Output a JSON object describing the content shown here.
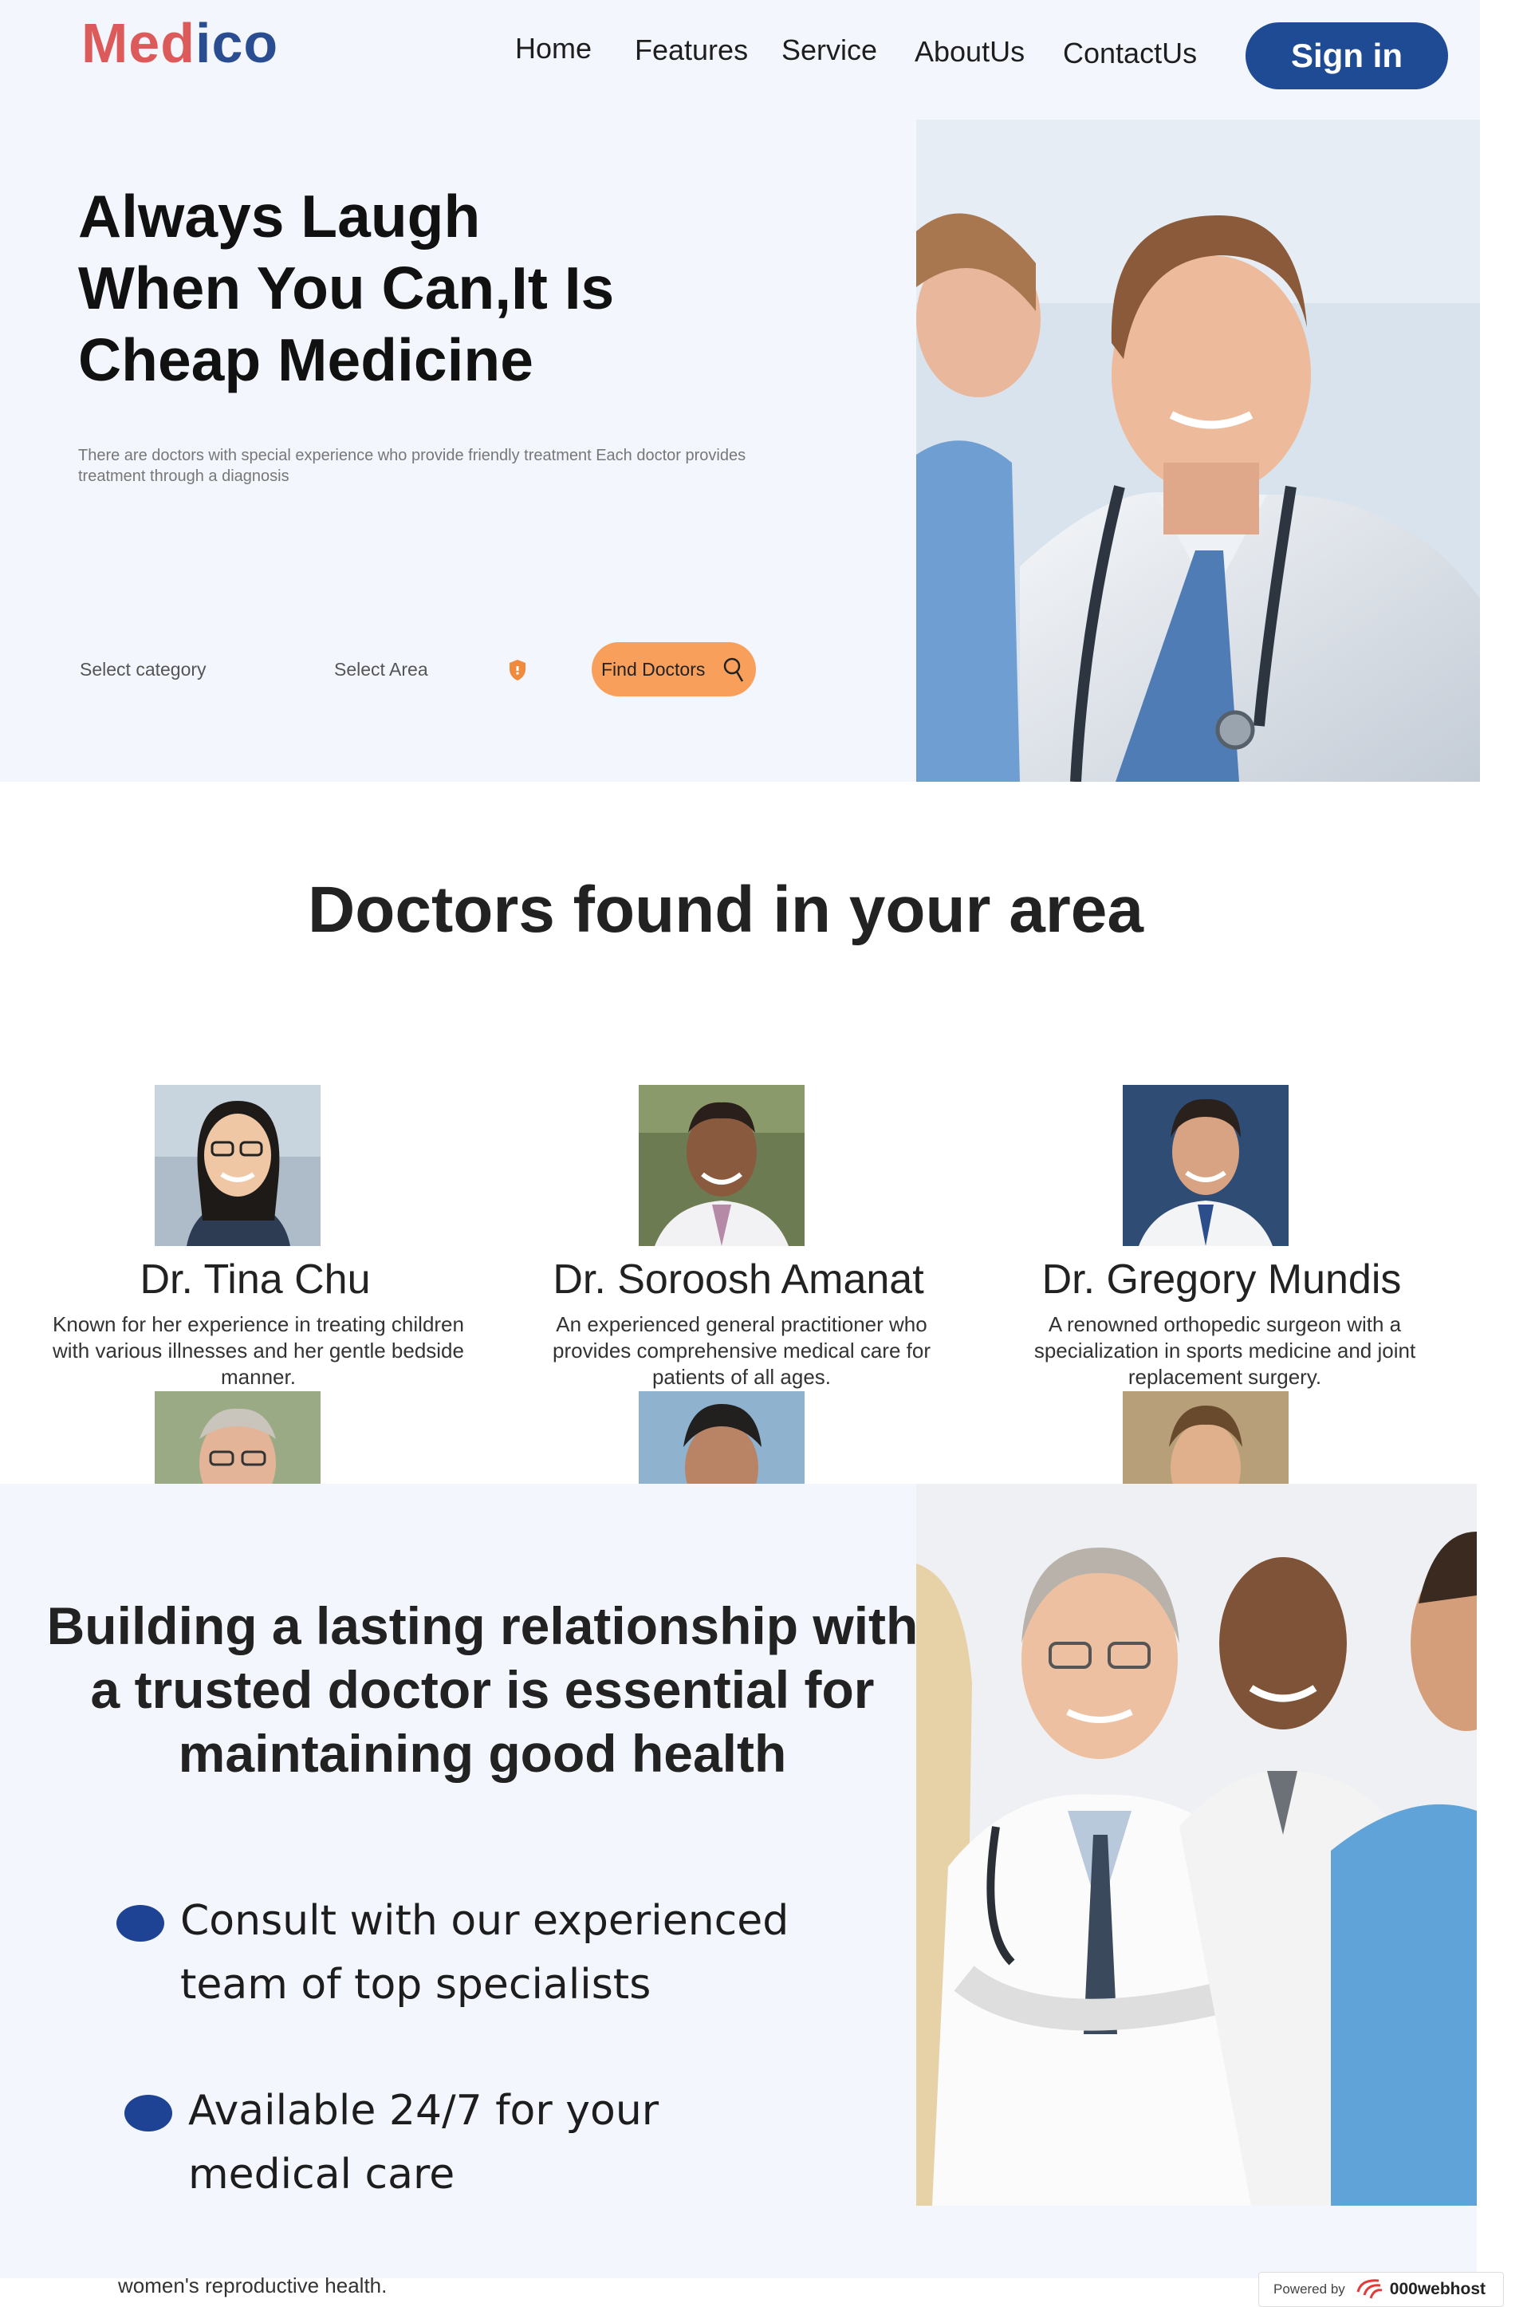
{
  "brand": {
    "part1": "Med",
    "part2": "ico"
  },
  "nav": {
    "home": "Home",
    "features": "Features",
    "service": "Service",
    "about": "AboutUs",
    "contact": "ContactUs",
    "signin": "Sign in"
  },
  "hero": {
    "title_lines": [
      "Always Laugh",
      "When You Can,It Is",
      "Cheap Medicine"
    ],
    "description": "There are doctors with special experience who provide friendly treatment Each doctor provides treatment through a diagnosis",
    "category": "Select category",
    "area": "Select Area",
    "find": "Find Doctors"
  },
  "doctors": {
    "title": "Doctors found in your area",
    "list": [
      {
        "name": "Dr. Tina Chu",
        "desc": "Known for her experience in treating children with various illnesses and her gentle bedside manner."
      },
      {
        "name": "Dr. Soroosh Amanat",
        "desc": "An experienced general practitioner who provides comprehensive medical care for patients of all ages."
      },
      {
        "name": "Dr. Gregory Mundis",
        "desc": "A renowned orthopedic surgeon with a specialization in sports medicine and joint replacement surgery."
      }
    ]
  },
  "relationship": {
    "title": "Building a lasting relationship with a trusted doctor is essential for maintaining good health",
    "points": [
      {
        "line1": "Consult with our experienced",
        "line2": "team of top specialists"
      },
      {
        "line1": "Available 24/7 for your",
        "line2": "medical care"
      }
    ]
  },
  "cutoff_text": "women's reproductive health.",
  "badge": {
    "prefix": "Powered by",
    "brand": "000webhost"
  },
  "colors": {
    "accent": "#1f4b94",
    "logo_red": "#dd5a5a",
    "find_button": "#f8a05b",
    "hero_bg": "#f3f7fd"
  }
}
